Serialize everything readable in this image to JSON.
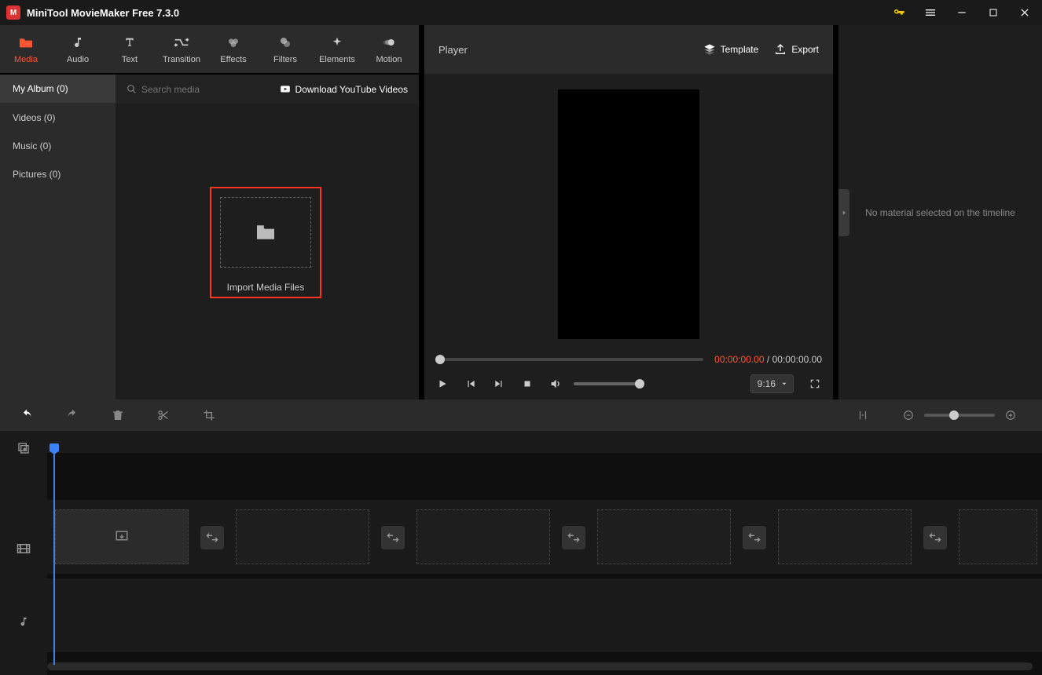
{
  "titlebar": {
    "title": "MiniTool MovieMaker Free 7.3.0"
  },
  "toolbar": {
    "items": [
      {
        "label": "Media"
      },
      {
        "label": "Audio"
      },
      {
        "label": "Text"
      },
      {
        "label": "Transition"
      },
      {
        "label": "Effects"
      },
      {
        "label": "Filters"
      },
      {
        "label": "Elements"
      },
      {
        "label": "Motion"
      }
    ]
  },
  "sidebar": {
    "items": [
      {
        "label": "My Album (0)"
      },
      {
        "label": "Videos (0)"
      },
      {
        "label": "Music (0)"
      },
      {
        "label": "Pictures (0)"
      }
    ]
  },
  "media": {
    "search_placeholder": "Search media",
    "download_label": "Download YouTube Videos",
    "import_label": "Import Media Files"
  },
  "player": {
    "title": "Player",
    "template_label": "Template",
    "export_label": "Export",
    "time_current": "00:00:00.00",
    "time_sep": " / ",
    "time_total": "00:00:00.00",
    "ratio": "9:16"
  },
  "right": {
    "empty_msg": "No material selected on the timeline"
  }
}
